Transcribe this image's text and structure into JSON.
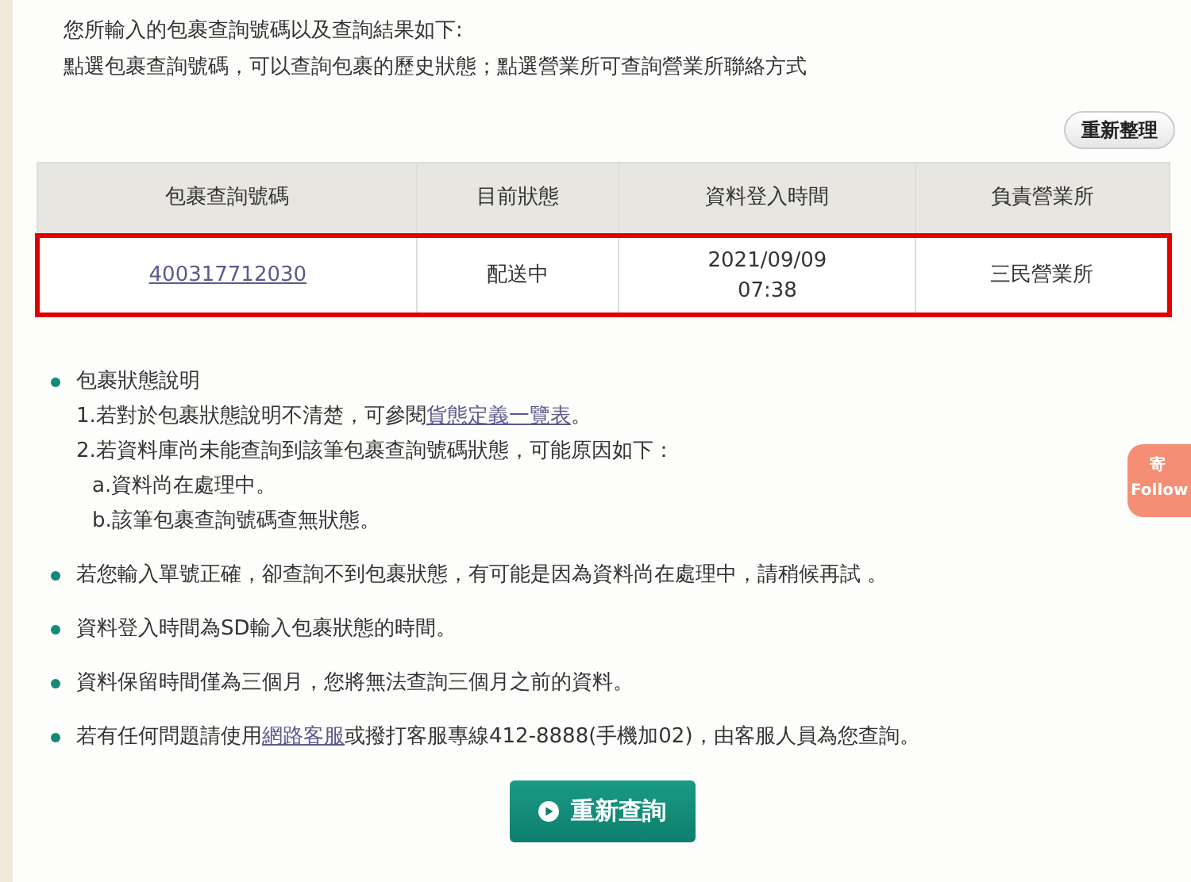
{
  "intro": [
    "您所輸入的包裹查詢號碼以及查詢結果如下:",
    "點選包裹查詢號碼，可以查詢包裹的歷史狀態；點選營業所可查詢營業所聯絡方式"
  ],
  "reset_button": "重新整理",
  "table": {
    "columns": [
      "包裹查詢號碼",
      "目前狀態",
      "資料登入時間",
      "負責營業所"
    ],
    "rows": [
      {
        "selected": true,
        "cells": [
          "400317712030",
          "配送中",
          "2021/09/09\n07:38",
          "三民營業所"
        ]
      }
    ]
  },
  "notes": [
    {
      "title": "包裹狀態說明",
      "lines": [
        [
          {
            "text": "1.若對於包裹狀態說明不清楚，可參閱"
          },
          {
            "text": "貨態定義一覽表",
            "link": true
          },
          {
            "text": "。"
          }
        ],
        [
          {
            "text": "2.若資料庫尚未能查詢到該筆包裹查詢號碼狀態，可能原因如下："
          }
        ],
        [
          {
            "text": "a.資料尚在處理中。",
            "indent": true
          }
        ],
        [
          {
            "text": "b.該筆包裹查詢號碼查無狀態。",
            "indent": true
          }
        ]
      ]
    },
    {
      "segments": [
        {
          "text": "若您輸入單號正確，卻查詢不到包裹狀態，有可能是因為資料尚在處理中，請稍候再試 。"
        }
      ]
    },
    {
      "segments": [
        {
          "text": "資料登入時間為SD輸入包裹狀態的時間。"
        }
      ]
    },
    {
      "segments": [
        {
          "text": "資料保留時間僅為三個月，您將無法查詢三個月之前的資料。"
        }
      ]
    },
    {
      "segments": [
        {
          "text": "若有任何問題請使用"
        },
        {
          "text": "網路客服",
          "link": true
        },
        {
          "text": "或撥打客服專線412-8888(手機加02)，由客服人員為您查詢。"
        }
      ]
    }
  ],
  "query_button": "重新查詢",
  "follow_badge": [
    "寄",
    "Follow"
  ]
}
